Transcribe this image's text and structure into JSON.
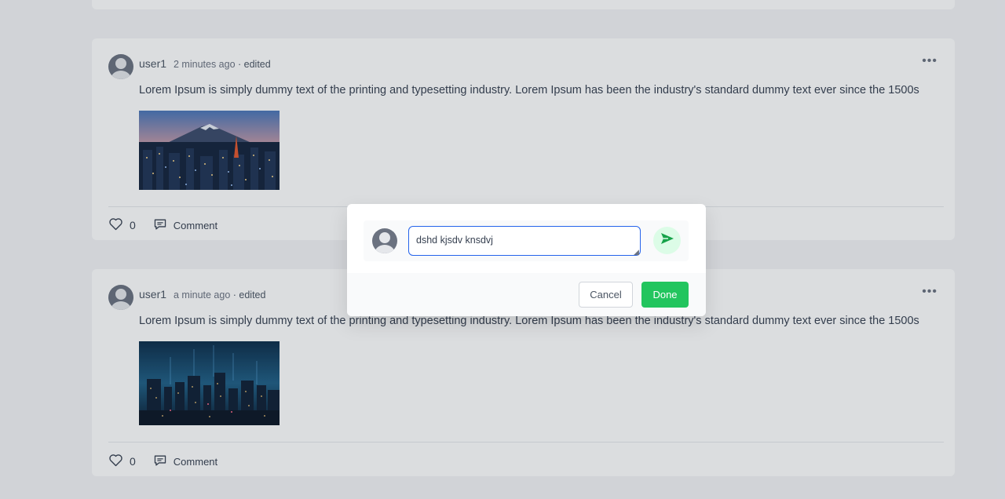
{
  "posts": [
    {
      "user": "user1",
      "time": "2 minutes ago",
      "edited": "· edited",
      "text": "Lorem Ipsum is simply dummy text of the printing and typesetting industry. Lorem Ipsum has been the industry's standard dummy text ever since the 1500s",
      "likes": "0",
      "comment_label": "Comment",
      "image": "tokyo-cityscape-mount-fuji"
    },
    {
      "user": "user1",
      "time": "a minute ago",
      "edited": "· edited",
      "text": "Lorem Ipsum is simply dummy text of the printing and typesetting industry. Lorem Ipsum has been the industry's standard dummy text ever since the 1500s",
      "likes": "0",
      "comment_label": "Comment",
      "image": "night-city-skyline"
    }
  ],
  "modal": {
    "input_value": "dshd kjsdv knsdvj",
    "cancel_label": "Cancel",
    "done_label": "Done"
  },
  "icons": {
    "more": "ellipsis-icon",
    "like": "heart-icon",
    "comment": "comment-icon",
    "send": "send-icon",
    "avatar": "user-avatar-icon"
  },
  "colors": {
    "accent_blue": "#2563eb",
    "done_green": "#22c55e",
    "send_bg": "#dcfce7",
    "send_icon": "#16a34a"
  }
}
